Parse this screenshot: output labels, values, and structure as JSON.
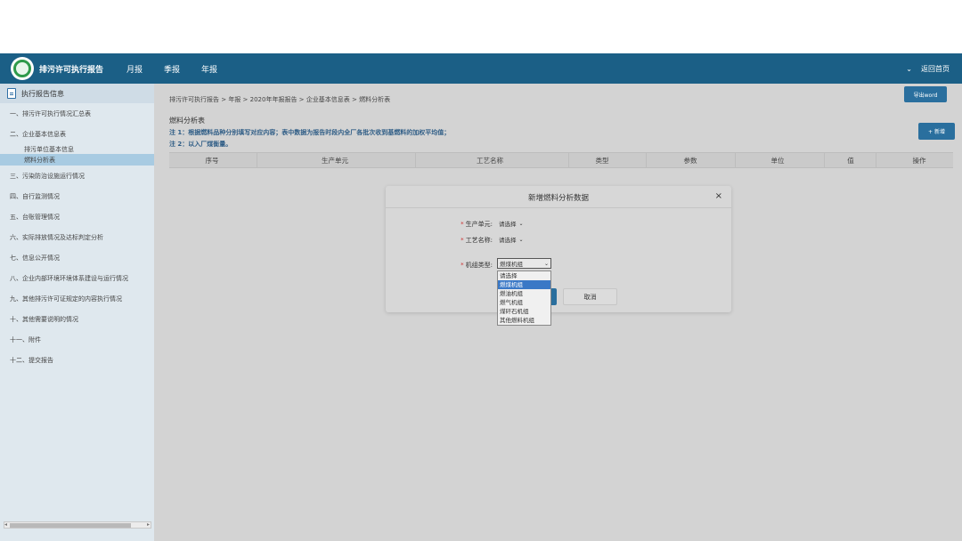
{
  "topbar": {
    "app_title": "排污许可执行报告",
    "nav": [
      "月报",
      "季报",
      "年报"
    ],
    "return_home": "返回首页",
    "brand_color": "#1b5f86"
  },
  "sidebar": {
    "header": "执行报告信息",
    "items": [
      "一、排污许可执行情况汇总表",
      "二、企业基本信息表",
      "三、污染防治设施运行情况",
      "四、自行监测情况",
      "五、台账管理情况",
      "六、实际排放情况及达标判定分析",
      "七、信息公开情况",
      "八、企业内部环境环境体系建设与运行情况",
      "九、其他排污许可证规定的内容执行情况",
      "十、其他需要说明的情况",
      "十一、附件",
      "十二、提交报告"
    ],
    "sub_items": [
      "排污单位基本信息",
      "燃料分析表"
    ]
  },
  "main": {
    "breadcrumb": "排污许可执行报告 > 年报 > 2020年年报报告 > 企业基本信息表 > 燃料分析表",
    "export_label": "导出word",
    "section_title": "燃料分析表",
    "note1": "注 1：根据燃料品种分别填写对应内容；表中数据为报告时段内全厂各批次收到基燃料的加权平均值；",
    "note2": "注 2：以入厂煤衡量。",
    "add_label": "+ 新增",
    "columns": [
      "序号",
      "生产单元",
      "工艺名称",
      "类型",
      "参数",
      "单位",
      "值",
      "操作"
    ]
  },
  "modal": {
    "title": "新增燃料分析数据",
    "close": "×",
    "fields": [
      {
        "label": "生产单元:",
        "value": "请选择"
      },
      {
        "label": "工艺名称:",
        "value": "请选择"
      },
      {
        "label": "机组类型:",
        "value": "燃煤机组"
      }
    ],
    "dropdown_options": [
      "请选择",
      "燃煤机组",
      "燃油机组",
      "燃气机组",
      "煤矸石机组",
      "其他燃料机组"
    ],
    "cancel_label": "取消"
  }
}
